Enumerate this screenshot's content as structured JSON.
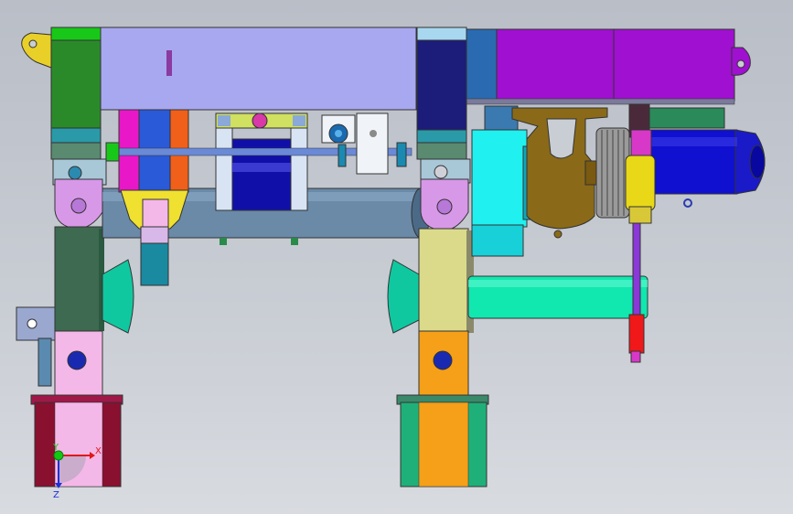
{
  "viewport": {
    "background_top": "#b9bec7",
    "background_bottom": "#d8dbe0"
  },
  "triad": {
    "x_label": "X",
    "y_label": "Y",
    "z_label": "Z",
    "x_color": "#e01818",
    "y_color": "#12c812",
    "z_color": "#1f2fd8"
  },
  "colors": {
    "beam": "#a8a8f0",
    "left_post_top": "#2a8a2a",
    "left_post_mid": "#3d7a5a",
    "left_leg_pink": "#f4b8e8",
    "right_post_top": "#1c1c7a",
    "right_leg_yellow": "#dada8a",
    "right_leg_orange": "#f5a018",
    "magenta_box": "#a010d0",
    "cyan_motor": "#20f0f0",
    "blue_motor": "#1010d0",
    "shaft_teal": "#10e8b0",
    "gearbox_olive": "#8a6a18",
    "base_maroon": "#8a1030",
    "cylinder_slate": "#6a8aa8"
  }
}
